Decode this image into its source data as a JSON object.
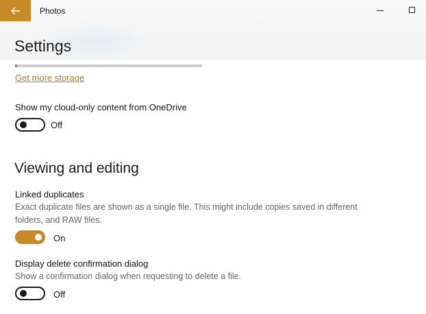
{
  "app": {
    "title": "Photos",
    "accent_color": "#c88a26"
  },
  "titlebar": {
    "back_icon": "arrow-left-icon",
    "minimize_icon": "minimize-icon",
    "maximize_icon": "maximize-icon"
  },
  "page": {
    "title": "Settings"
  },
  "storage": {
    "used_fraction": 0.01,
    "link_label": "Get more storage"
  },
  "onedrive": {
    "label": "Show my cloud-only content from OneDrive",
    "state": "Off"
  },
  "viewing": {
    "heading": "Viewing and editing",
    "linked_duplicates": {
      "label": "Linked duplicates",
      "description": "Exact duplicate files are shown as a single file. This might include copies saved in different folders, and RAW files.",
      "state": "On"
    },
    "delete_confirm": {
      "label": "Display delete confirmation dialog",
      "description": "Show a confirmation dialog when requesting to delete a file.",
      "state": "Off"
    }
  }
}
